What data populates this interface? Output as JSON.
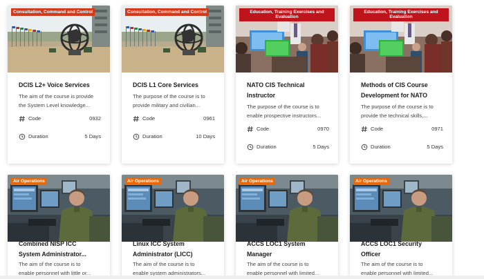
{
  "cards": [
    {
      "category": "Consultation, Command and Control",
      "title_lines": [
        "DCIS L2+ Voice Services"
      ],
      "desc_lines": [
        "The aim of the course is provide",
        "the System Level knowledge..."
      ],
      "code_label": "Code",
      "code": "0932",
      "duration_label": "Duration",
      "duration": "5 Days"
    },
    {
      "category": "Consultation, Command and Control",
      "title_lines": [
        "DCIS L1 Core Services"
      ],
      "desc_lines": [
        "The purpose of the course is to",
        "provide military and civilian..."
      ],
      "code_label": "Code",
      "code": "0961",
      "duration_label": "Duration",
      "duration": "10 Days"
    },
    {
      "category": "Education, Training Exercises and Evaluation",
      "title_lines": [
        "NATO CIS Technical",
        "Instructor"
      ],
      "desc_lines": [
        "The purpose of the course is to",
        "enable prospective instructors..."
      ],
      "code_label": "Code",
      "code": "0970",
      "duration_label": "Duration",
      "duration": "5 Days"
    },
    {
      "category": "Education, Training Exercises and Evaluation",
      "title_lines": [
        "Methods of CIS Course",
        "Development for NATO"
      ],
      "desc_lines": [
        "The purpose of the course is to",
        "provide the technical skills,..."
      ],
      "code_label": "Code",
      "code": "0971",
      "duration_label": "Duration",
      "duration": "5 Days"
    },
    {
      "category": "Air Operations",
      "title_lines": [
        "Combined NISP ICC",
        "System Administrator..."
      ],
      "desc_lines": [
        "The aim of the course is to",
        "enable personnel with little or..."
      ]
    },
    {
      "category": "Air Operations",
      "title_lines": [
        "Linux ICC System",
        "Administrator (LICC)"
      ],
      "desc_lines": [
        "The aim of the course is to",
        "enable system administrators..."
      ]
    },
    {
      "category": "Air Operations",
      "title_lines": [
        "ACCS LOC1 System",
        "Manager"
      ],
      "desc_lines": [
        "The aim of the course is to",
        "enable personnel with limited..."
      ]
    },
    {
      "category": "Air Operations",
      "title_lines": [
        "ACCS LOC1 Security",
        "Officer"
      ],
      "desc_lines": [
        "The aim of the course is to",
        "enable personnel with limited..."
      ]
    }
  ]
}
